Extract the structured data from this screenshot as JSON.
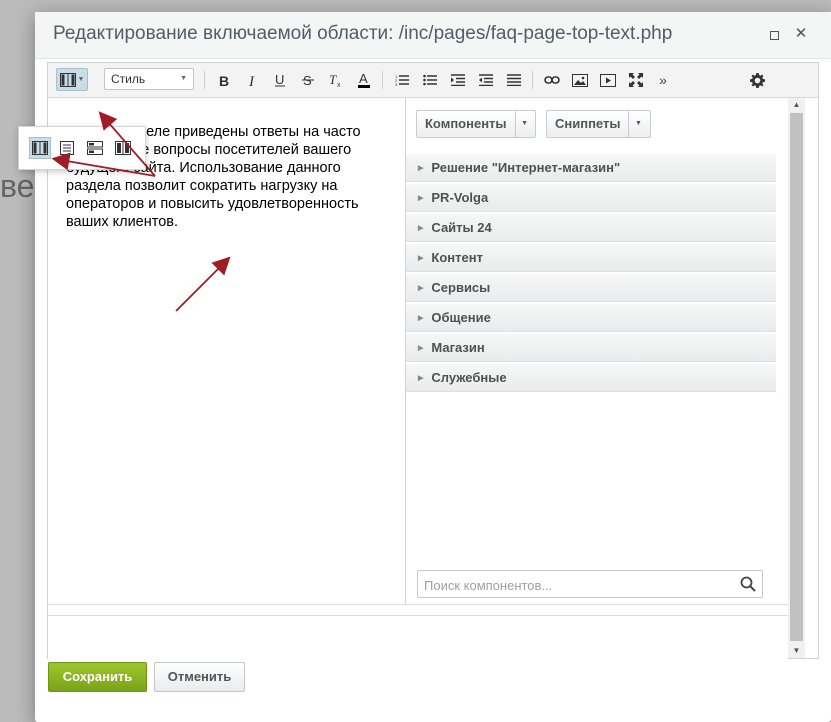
{
  "dialog": {
    "title": "Редактирование включаемой области: /inc/pages/faq-page-top-text.php"
  },
  "editor": {
    "style_select": "Стиль",
    "content_text": "В этом разделе приведены ответы на часто задаваемые вопросы посетителей вашего будущего сайта. Использование данного раздела позволит сократить нагрузку на операторов и повысить удовлетворенность ваших клиентов."
  },
  "components_panel": {
    "components_button": "Компоненты",
    "snippets_button": "Сниппеты",
    "items": [
      "Решение \"Интернет-магазин\"",
      "PR-Volga",
      "Сайты 24",
      "Контент",
      "Сервисы",
      "Общение",
      "Магазин",
      "Служебные"
    ],
    "search_placeholder": "Поиск компонентов..."
  },
  "footer": {
    "save_label": "Сохранить",
    "cancel_label": "Отменить"
  },
  "colors": {
    "save_button": "#8bb320",
    "arrow": "#a01d26",
    "active_mode": "#c9dde6"
  }
}
